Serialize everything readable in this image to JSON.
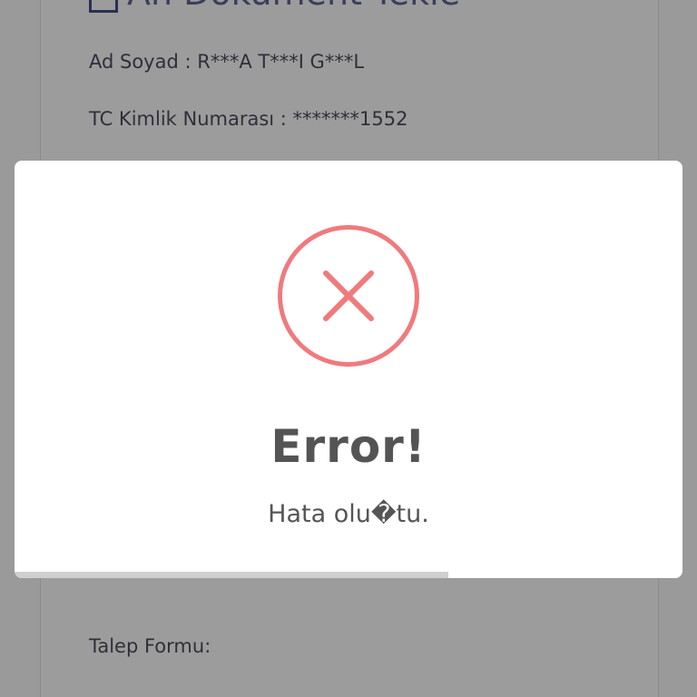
{
  "background": {
    "header_title": "An Dokument Tekle",
    "full_name_line": "Ad Soyad : R***A T***I G***L",
    "tc_line": "TC Kimlik Numarası : *******1552",
    "request_form_line": "Talep Formu:"
  },
  "modal": {
    "icon": "error-x-icon",
    "icon_color": "#f07a7d",
    "title": "Error!",
    "message": "Hata olu�tu.",
    "timer_progress_percent": 65
  }
}
